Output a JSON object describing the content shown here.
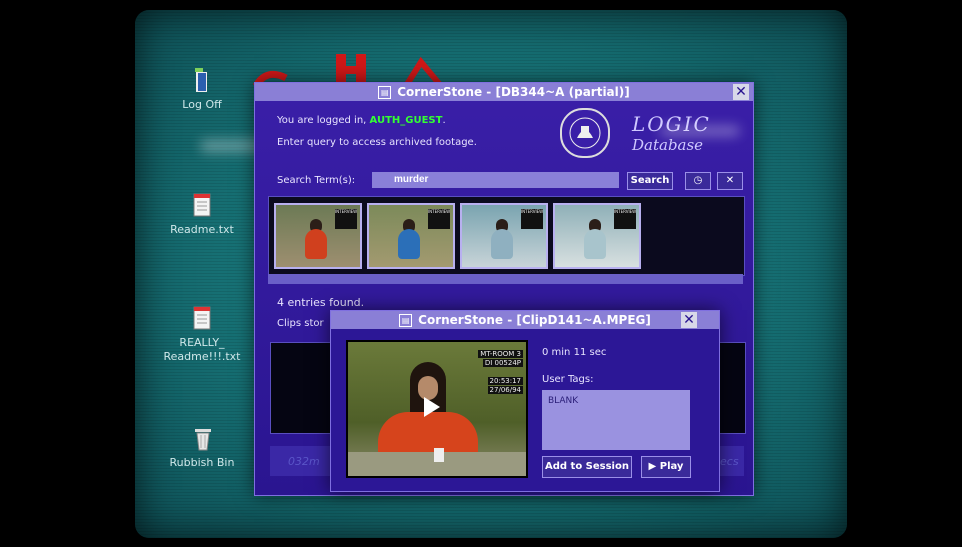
{
  "desktop": {
    "icons": [
      {
        "label": "Log Off"
      },
      {
        "label": "Readme.txt"
      },
      {
        "label": "REALLY_",
        "label2": "Readme!!!.txt"
      },
      {
        "label": "Rubbish Bin"
      }
    ]
  },
  "main_window": {
    "title": "CornerStone - [DB344~A (partial)]",
    "logged_in_prefix": "You are logged in, ",
    "user": "AUTH_GUEST",
    "logged_in_suffix": ".",
    "instruction": "Enter query to access archived footage.",
    "logo_text": "LOGIC",
    "logo_sub": "Database",
    "search_label": "Search Term(s):",
    "search_value": "murder",
    "search_button": "Search",
    "thumbnails": [
      {
        "room": "INTERVIEW"
      },
      {
        "room": "INTERVIEW"
      },
      {
        "room": "INTERVIEW"
      },
      {
        "room": "INTERVIEW"
      }
    ],
    "entries_found": "4 entries found.",
    "clips_stored_partial": "Clips stor",
    "session_left_partial": "032m",
    "session_right_partial": "ecs"
  },
  "clip_window": {
    "title": "CornerStone - [ClipD141~A.MPEG]",
    "overlay_room": "MT-ROOM 3",
    "overlay_code": "DI 00524P",
    "overlay_time": "20:53:17",
    "overlay_date": "27/06/94",
    "duration": "0 min 11 sec",
    "user_tags_label": "User Tags:",
    "tag_value": "BLANK",
    "add_button": "Add to Session",
    "play_button": "Play"
  },
  "colors": {
    "window_bg": "#2a1590",
    "titlebar": "#8a7fd6",
    "user_green": "#33ff33",
    "desktop": "#166f73"
  }
}
